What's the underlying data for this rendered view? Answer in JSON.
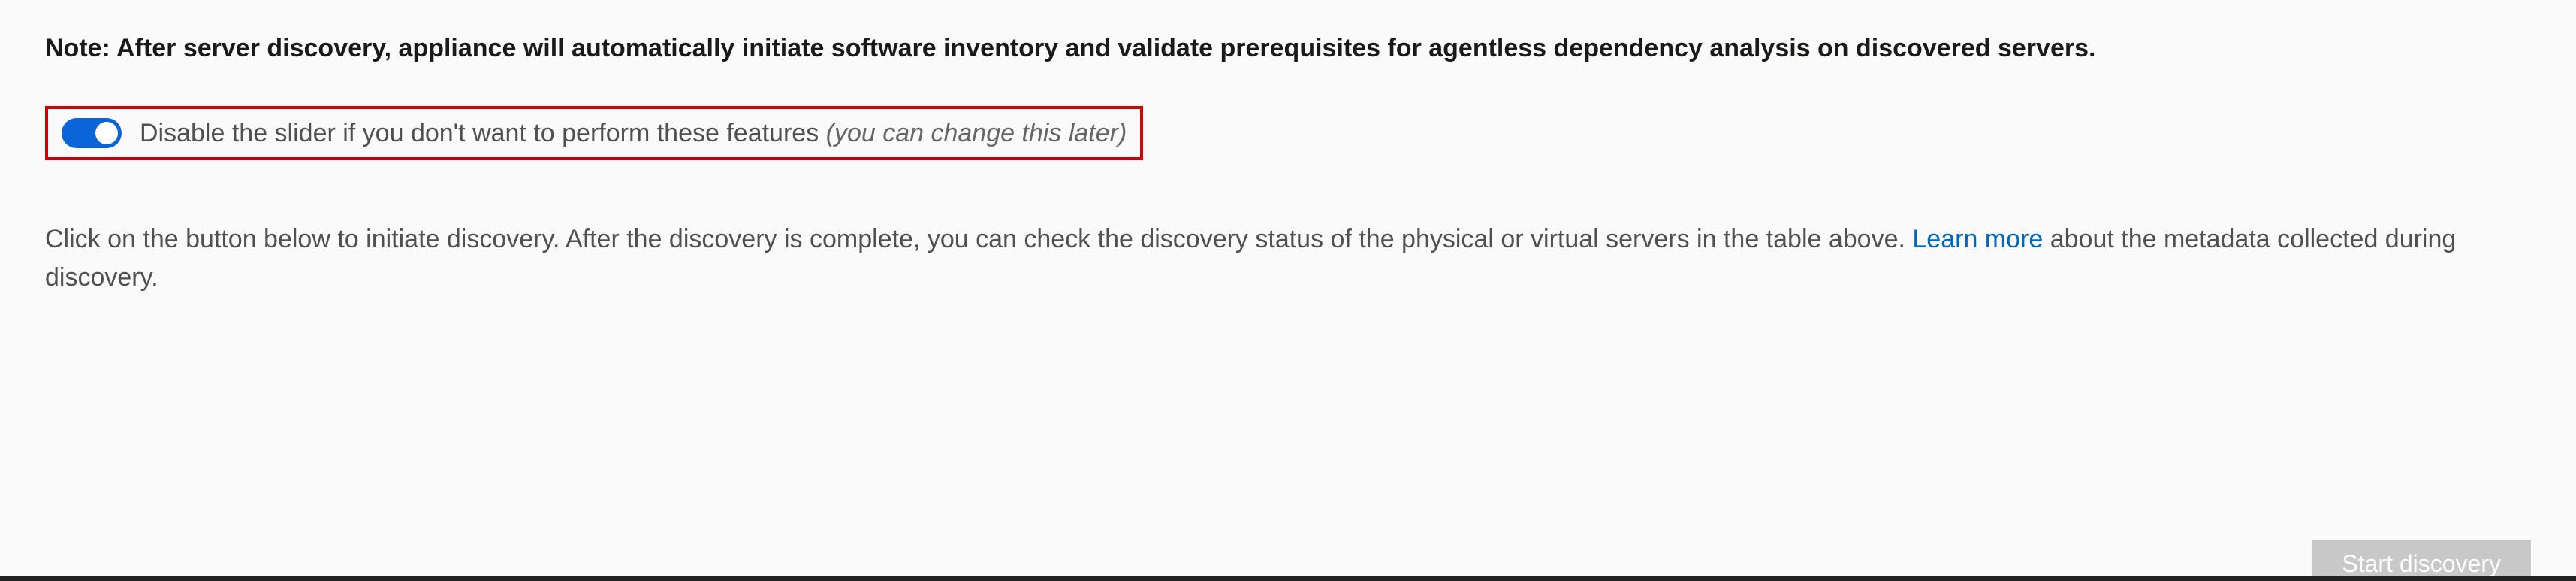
{
  "note": {
    "text": "Note: After server discovery, appliance will automatically initiate software inventory and validate prerequisites for agentless dependency analysis on discovered servers."
  },
  "toggle": {
    "label": "Disable the slider if you don't want to perform these features ",
    "hint": "(you can change this later)",
    "enabled": true
  },
  "body": {
    "pre": "Click on the button below to initiate discovery. After the discovery is complete, you can check the discovery status of the physical or virtual servers in the table above. ",
    "link": "Learn more",
    "post": " about the metadata collected during discovery."
  },
  "buttons": {
    "start": "Start discovery"
  }
}
